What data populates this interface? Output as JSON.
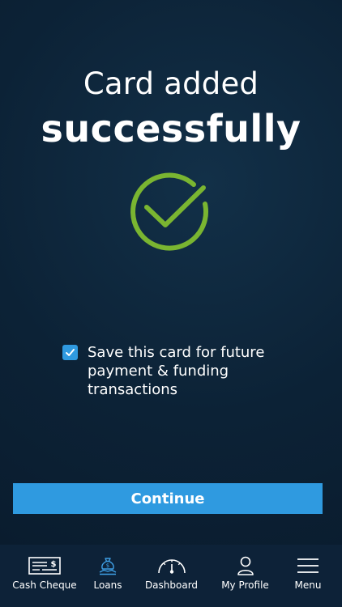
{
  "heading": {
    "line1": "Card added",
    "line2": "successfully"
  },
  "success_icon": "check-circle-icon",
  "save_card": {
    "checked": true,
    "label": "Save this card for future payment & funding transactions"
  },
  "continue_label": "Continue",
  "tabbar": {
    "items": [
      {
        "label": "Cash Cheque",
        "icon": "cheque-icon"
      },
      {
        "label": "Loans",
        "icon": "money-bag-icon"
      },
      {
        "label": "Dashboard",
        "icon": "gauge-icon"
      },
      {
        "label": "My Profile",
        "icon": "person-icon"
      },
      {
        "label": "Menu",
        "icon": "hamburger-icon"
      }
    ]
  },
  "colors": {
    "background": "#0c2236",
    "accent": "#2f9ae0",
    "success": "#7ab531",
    "tabbar": "#0d2238"
  }
}
